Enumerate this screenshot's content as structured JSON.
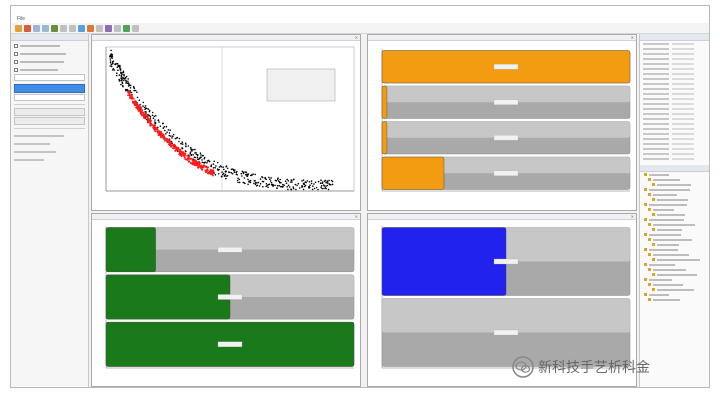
{
  "window": {
    "title": "",
    "menu": [
      "File",
      "",
      "",
      "",
      ""
    ]
  },
  "left_panel": {
    "title": "",
    "blue_button": "",
    "button_1": "",
    "button_2": ""
  },
  "panes": {
    "scatter": {
      "title": "",
      "legend": [
        "",
        "",
        ""
      ],
      "colors": {
        "black": "#000000",
        "red": "#ff1a1a"
      }
    },
    "orange_bars": {
      "fill_color": "#f39c12",
      "bars": [
        {
          "fraction": 1.0,
          "label": ""
        },
        {
          "fraction": 0.02,
          "label": ""
        },
        {
          "fraction": 0.02,
          "label": ""
        },
        {
          "fraction": 0.25,
          "label": ""
        }
      ]
    },
    "green_bars": {
      "fill_color": "#1a7a1a",
      "bars": [
        {
          "fraction": 0.2,
          "label": ""
        },
        {
          "fraction": 0.5,
          "label": ""
        },
        {
          "fraction": 1.0,
          "label": ""
        }
      ]
    },
    "blue_bars": {
      "fill_color": "#2222ee",
      "bars": [
        {
          "fraction": 0.5,
          "label": ""
        },
        {
          "fraction": 0.0,
          "label": ""
        }
      ]
    }
  },
  "right_panel": {
    "title_1": "",
    "title_2": ""
  },
  "watermark": {
    "text": "新科技手艺析科金"
  },
  "icons": [
    "window-icon",
    "toolbar-icon",
    "wechat-logo-icon"
  ]
}
